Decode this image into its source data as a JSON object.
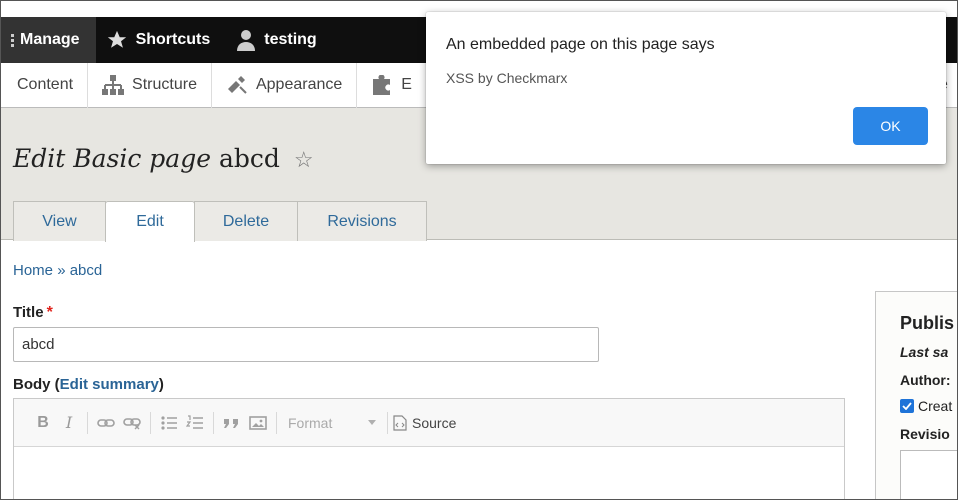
{
  "toolbar": {
    "manage": "Manage",
    "shortcuts": "Shortcuts",
    "user": "testing"
  },
  "tray": {
    "items": [
      "Content",
      "Structure",
      "Appearance",
      "E",
      "e"
    ]
  },
  "header": {
    "title_italic": "Edit Basic page",
    "title_rest": "abcd",
    "tabs": [
      "View",
      "Edit",
      "Delete",
      "Revisions"
    ]
  },
  "breadcrumb": {
    "home": "Home",
    "sep": "»",
    "current": "abcd"
  },
  "form": {
    "title_label": "Title",
    "title_required": "*",
    "title_value": "abcd",
    "body_label": "Body",
    "body_open": "(",
    "edit_summary": "Edit summary",
    "body_close": ")"
  },
  "editor": {
    "bold": "B",
    "italic": "I",
    "format": "Format",
    "source": "Source"
  },
  "sidebar": {
    "heading": "Publis",
    "last_saved": "Last sa",
    "author": "Author:",
    "create": "Creat",
    "revision": "Revisio"
  },
  "dialog": {
    "title": "An embedded page on this page says",
    "message": "XSS by Checkmarx",
    "ok": "OK"
  },
  "colors": {
    "toolbar_bg": "#0f0f0f",
    "header_bg": "#e7e6e1",
    "link": "#2a6496",
    "ok_button": "#2b86e6"
  }
}
